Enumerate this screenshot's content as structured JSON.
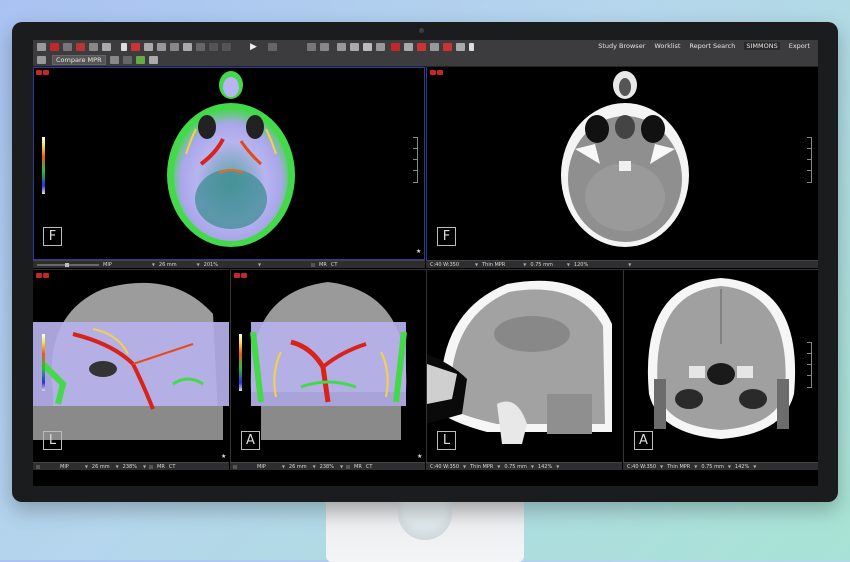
{
  "toolbar": {
    "compare_label": "Compare MPR",
    "nav": [
      "Study Browser",
      "Worklist",
      "Report Search",
      "SIMMONS",
      "Export"
    ],
    "active_nav_index": 3
  },
  "viewports": {
    "axial_fusion": {
      "orientation": "F",
      "status": {
        "mode": "MIP",
        "thickness": "26 mm",
        "zoom": "201%",
        "tag1": "MR",
        "tag2": "CT"
      }
    },
    "axial_ct": {
      "orientation": "F",
      "status": {
        "window": "C:40 W:350",
        "mode": "Thin MPR",
        "thickness": "0.75 mm",
        "zoom": "120%"
      }
    },
    "sagittal_fusion": {
      "orientation": "L",
      "status": {
        "mode": "MIP",
        "thickness": "26 mm",
        "zoom": "238%",
        "tag1": "MR",
        "tag2": "CT"
      }
    },
    "coronal_fusion": {
      "orientation": "A",
      "status": {
        "mode": "MIP",
        "thickness": "26 mm",
        "zoom": "238%",
        "tag1": "MR",
        "tag2": "CT"
      }
    },
    "sagittal_ct": {
      "orientation": "L",
      "status": {
        "window": "C:40 W:350",
        "mode": "Thin MPR",
        "thickness": "0.75 mm",
        "zoom": "142%"
      }
    },
    "coronal_ct": {
      "orientation": "A",
      "status": {
        "window": "C:40 W:350",
        "mode": "Thin MPR",
        "thickness": "0.75 mm",
        "zoom": "142%"
      }
    }
  },
  "colors": {
    "accent_selection": "#2a3c9a",
    "toolbar_bg": "#3c3c3e",
    "vessel_red": "#d8221a",
    "fusion_green": "#3fd84a",
    "fusion_lavender": "#b9b6f2"
  }
}
